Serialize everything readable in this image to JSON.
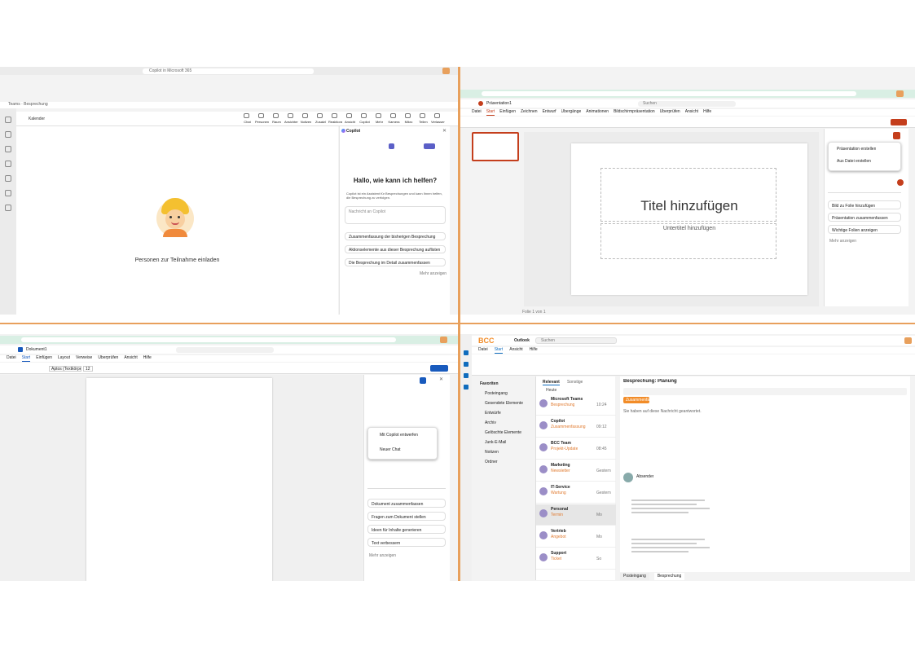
{
  "q1": {
    "search": "Copilot in Microsoft 365",
    "url_hint": "Teams · Besprechung",
    "meeting_title": "Kalender",
    "toolbar": [
      "Chat",
      "Personen",
      "Raum",
      "Ansichten",
      "Notizen",
      "Zusatzl",
      "Reaktionen",
      "Ansicht",
      "Copilot",
      "Mehr",
      "Kamera",
      "Mikro",
      "Teilen",
      "Verlassen"
    ],
    "copilot_header": "Copilot",
    "greeting": "Hallo, wie kann ich helfen?",
    "intro_text": "Copilot ist ein Assistent für Besprechungen und kann Ihnen helfen, die Besprechung zu verfolgen.",
    "input_placeholder": "Nachricht an Copilot",
    "suggestions": [
      "Zusammenfassung der bisherigen Besprechung",
      "Aktionselemente aus dieser Besprechung auflisten",
      "Die Besprechung im Detail zusammenfassen"
    ],
    "more_prompts": "Mehr anzeigen",
    "invite_text": "Personen zur Teilnahme einladen"
  },
  "q2": {
    "search": "Suchen",
    "doc_title": "Präsentation1",
    "tabs": [
      "Datei",
      "Start",
      "Einfügen",
      "Zeichnen",
      "Entwurf",
      "Übergänge",
      "Animationen",
      "Bildschirmpräsentation",
      "Überprüfen",
      "Ansicht",
      "Hilfe"
    ],
    "slide_title": "Titel hinzufügen",
    "slide_subtitle": "Untertitel hinzufügen",
    "panel_items": [
      "Präsentation erstellen",
      "Aus Datei erstellen",
      "Bild zu Folie hinzufügen",
      "Präsentation zusammenfassen",
      "Wichtige Folien anzeigen",
      "Mehr anzeigen"
    ],
    "status": "Folie 1 von 1"
  },
  "q3": {
    "doc_title": "Dokument1",
    "tabs": [
      "Datei",
      "Start",
      "Einfügen",
      "Layout",
      "Verweise",
      "Überprüfen",
      "Ansicht",
      "Hilfe"
    ],
    "font": "Aptos (Textkörper)",
    "size": "12",
    "panel_menu": [
      "Mit Copilot entwerfen",
      "Neuer Chat"
    ],
    "panel_items": [
      "Dokument zusammenfassen",
      "Fragen zum Dokument stellen",
      "Ideen für Inhalte generieren",
      "Text verbessern"
    ],
    "more_prompts": "Mehr anzeigen"
  },
  "q4": {
    "brand": "BCC",
    "app": "Outlook",
    "search": "Suchen",
    "tabs": [
      "Datei",
      "Start",
      "Ansicht",
      "Hilfe"
    ],
    "folders": [
      "Favoriten",
      "Posteingang",
      "Gesendete Elemente",
      "Entwürfe",
      "Archiv",
      "Gelöschte Elemente",
      "Junk-E-Mail",
      "Notizen",
      "Ordner"
    ],
    "filter_tabs": [
      "Relevant",
      "Sonstige"
    ],
    "mail_group_today": "Heute",
    "mails": [
      {
        "sender": "Microsoft Teams",
        "subject": "Besprechung",
        "time": "10:24"
      },
      {
        "sender": "Copilot",
        "subject": "Zusammenfassung",
        "time": "09:12"
      },
      {
        "sender": "BCC Team",
        "subject": "Projekt-Update",
        "time": "08:45"
      },
      {
        "sender": "Marketing",
        "subject": "Newsletter",
        "time": "Gestern"
      },
      {
        "sender": "IT-Service",
        "subject": "Wartung",
        "time": "Gestern"
      },
      {
        "sender": "Personal",
        "subject": "Termin",
        "time": "Mo"
      },
      {
        "sender": "Vertrieb",
        "subject": "Angebot",
        "time": "Mo"
      },
      {
        "sender": "Support",
        "subject": "Ticket",
        "time": "So"
      }
    ],
    "reading_subject": "Besprechung: Planung",
    "summary_btn": "Zusammenfassung",
    "from": "Absender",
    "reply_line": "Sie haben auf diese Nachricht geantwortet.",
    "bottom_tabs": [
      "Posteingang",
      "Besprechung"
    ]
  },
  "colors": {
    "accent_orange": "#e8a05c",
    "teams_purple": "#5b5fc7",
    "outlook_blue": "#0f6cbd",
    "ppt_orange": "#c43e1c",
    "word_blue": "#185abd",
    "bcc_orange": "#f28c28"
  }
}
